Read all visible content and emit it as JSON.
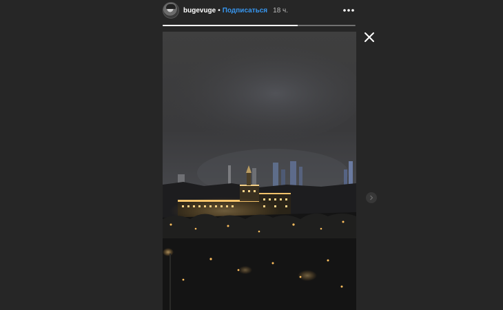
{
  "story": {
    "username": "bugevuge",
    "separator": "•",
    "follow_label": "Подписаться",
    "timestamp": "18 ч.",
    "progress": 0.7
  },
  "icons": {
    "avatar": "avatar",
    "more": "more-horizontal-icon",
    "close": "close-icon",
    "next": "chevron-right-icon"
  },
  "colors": {
    "background": "#262626",
    "link": "#3897f0",
    "text": "#ffffff"
  }
}
